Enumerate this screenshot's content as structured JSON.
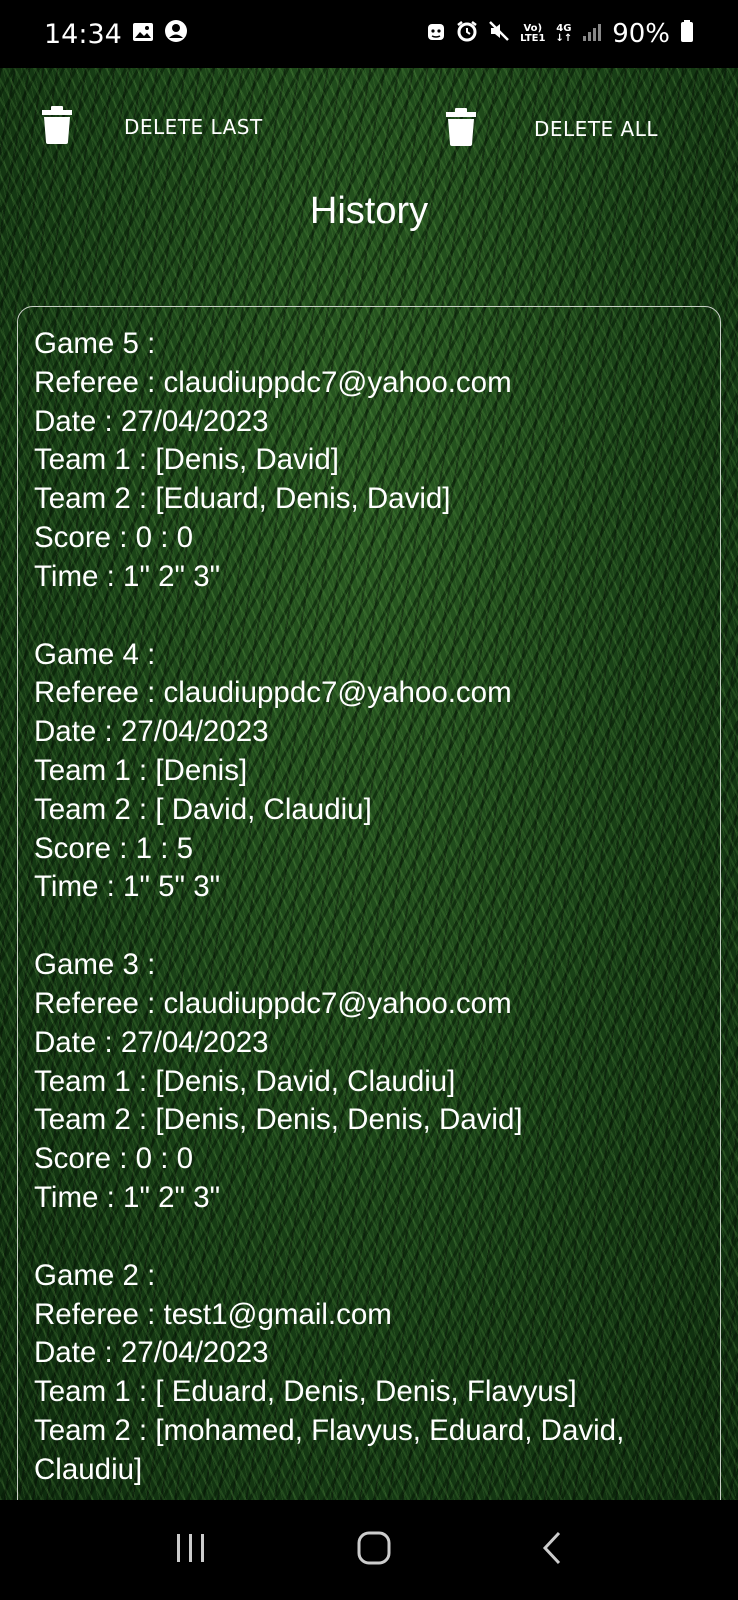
{
  "status_bar": {
    "time": "14:34",
    "net_top": "Vo)",
    "net_bottom": "LTE1",
    "net_4g": "4G",
    "battery": "90%"
  },
  "actions": {
    "delete_last": "DELETE LAST",
    "delete_all": "DELETE ALL"
  },
  "page": {
    "title": "History"
  },
  "games": [
    {
      "title": "Game 5 :",
      "referee": "Referee : claudiuppdc7@yahoo.com",
      "date": "Date : 27/04/2023",
      "team1": "Team 1 : [Denis,  David]",
      "team2": "Team 2 : [Eduard,  Denis,  David]",
      "score": "Score : 0 : 0",
      "time": "Time : 1\"  2\"  3\""
    },
    {
      "title": "Game 4 :",
      "referee": "Referee : claudiuppdc7@yahoo.com",
      "date": "Date : 27/04/2023",
      "team1": "Team 1 : [Denis]",
      "team2": "Team 2 : [ David,  Claudiu]",
      "score": "Score : 1 : 5",
      "time": "Time : 1\"  5\"  3\""
    },
    {
      "title": "Game 3 :",
      "referee": "Referee : claudiuppdc7@yahoo.com",
      "date": "Date : 27/04/2023",
      "team1": "Team 1 : [Denis,  David,  Claudiu]",
      "team2": "Team 2 : [Denis,  Denis,  Denis,  David]",
      "score": "Score : 0 : 0",
      "time": "Time : 1\"  2\"  3\""
    },
    {
      "title": "Game 2 :",
      "referee": "Referee : test1@gmail.com",
      "date": "Date : 27/04/2023",
      "team1": "Team 1 : [ Eduard,  Denis,  Denis,  Flavyus]",
      "team2": "Team 2 : [mohamed,  Flavyus,  Eduard,  David,",
      "team2_cont": "Claudiu]"
    }
  ],
  "icons": {
    "gallery": "image-icon",
    "account": "account-icon",
    "android": "android-icon",
    "alarm": "alarm-icon",
    "mute": "mute-icon",
    "signal": "signal-icon",
    "battery": "battery-icon",
    "trash": "trash-icon",
    "recents": "recents-icon",
    "home": "home-icon",
    "back": "back-icon"
  }
}
